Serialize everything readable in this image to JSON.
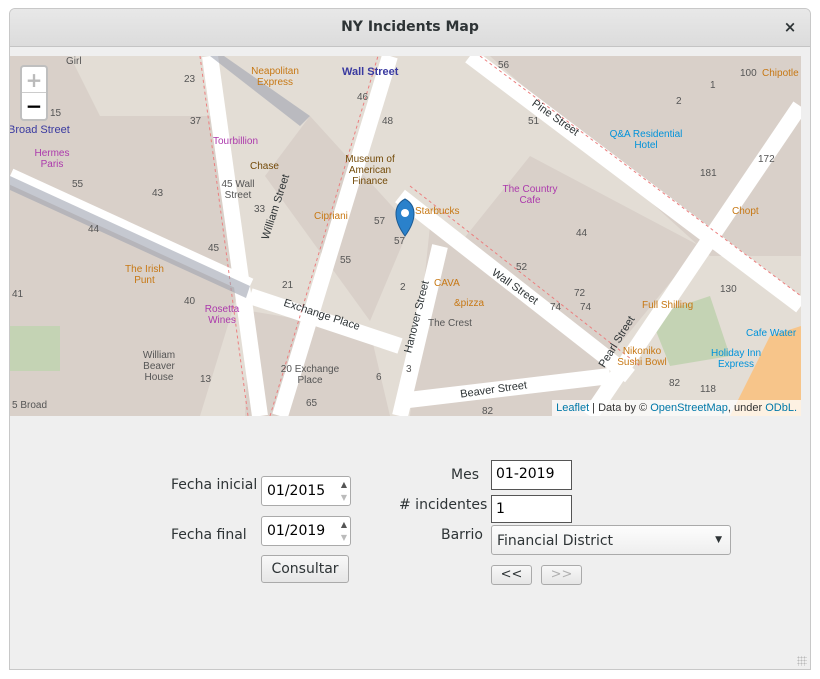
{
  "window": {
    "title": "NY Incidents Map",
    "close_label": "×"
  },
  "map": {
    "zoom_in": "+",
    "zoom_out": "−",
    "attribution": {
      "leaflet": "Leaflet",
      "data_by": " | Data by © ",
      "osm": "OpenStreetMap",
      "under": ", under ",
      "odbl": "ODbL."
    },
    "streets": [
      "Wall Street",
      "Pine Street",
      "William Street",
      "Exchange Place",
      "Hanover Street",
      "Beaver Street",
      "Pearl Street",
      "Broad Street"
    ],
    "pois": [
      "Neapolitan Express",
      "Tourbillion",
      "Chase",
      "Museum of American Finance",
      "Starbucks",
      "The Country Cafe",
      "Q&A Residential Hotel",
      "Chipotle",
      "Chopt",
      "45 Wall Street",
      "Cipriani",
      "Hermes Paris",
      "The Irish Punt",
      "Rosetta Wines",
      "William Beaver House",
      "20 Exchange Place",
      "CAVA",
      "&pizza",
      "The Crest",
      "Full Shilling",
      "Cafe Water",
      "Nikoniko Sushi Bowl",
      "Holiday Inn Express",
      "5 Broad"
    ],
    "numbers": [
      "Girl",
      "23",
      "37",
      "15",
      "55",
      "43",
      "44",
      "45",
      "40",
      "41",
      "33",
      "46",
      "48",
      "57",
      "57",
      "55",
      "21",
      "56",
      "51",
      "2",
      "1",
      "100",
      "181",
      "172",
      "44",
      "52",
      "72",
      "74",
      "130",
      "74",
      "82",
      "118",
      "82",
      "6",
      "3",
      "13",
      "65",
      "2"
    ]
  },
  "form": {
    "fecha_inicial_label": "Fecha inicial",
    "fecha_inicial_value": "01/2015",
    "fecha_final_label": "Fecha final",
    "fecha_final_value": "01/2019",
    "consultar": "Consultar",
    "mes_label": "Mes",
    "mes_value": "01-2019",
    "incidentes_label": "# incidentes",
    "incidentes_value": "1",
    "barrio_label": "Barrio",
    "barrio_value": "Financial District",
    "prev_button": "<<",
    "next_button": ">>"
  }
}
